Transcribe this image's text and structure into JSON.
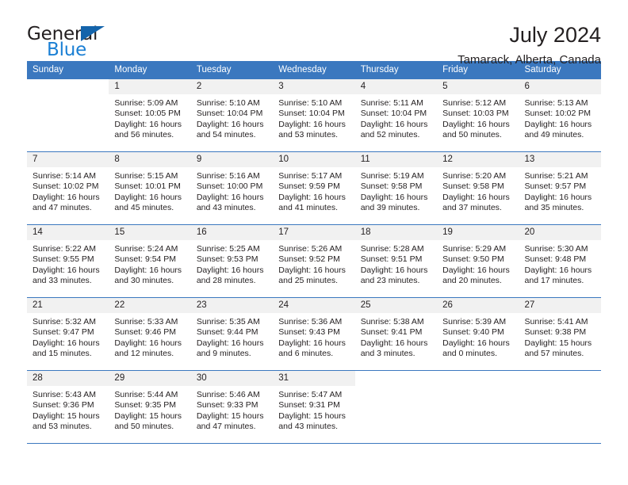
{
  "brand": {
    "name_part1": "General",
    "name_part2": "Blue",
    "triangle_color": "#1464ab",
    "blue_color": "#1a7fd4"
  },
  "header": {
    "title": "July 2024",
    "location": "Tamarack, Alberta, Canada"
  },
  "theme": {
    "header_blue": "#3b78bf",
    "daynum_band": "#f1f1f1",
    "text": "#231f20"
  },
  "weekday_headers": [
    "Sunday",
    "Monday",
    "Tuesday",
    "Wednesday",
    "Thursday",
    "Friday",
    "Saturday"
  ],
  "weeks": [
    [
      {
        "day": "",
        "sunrise": "",
        "sunset": "",
        "daylight1": "",
        "daylight2": "",
        "blank": true
      },
      {
        "day": "1",
        "sunrise": "Sunrise: 5:09 AM",
        "sunset": "Sunset: 10:05 PM",
        "daylight1": "Daylight: 16 hours",
        "daylight2": "and 56 minutes."
      },
      {
        "day": "2",
        "sunrise": "Sunrise: 5:10 AM",
        "sunset": "Sunset: 10:04 PM",
        "daylight1": "Daylight: 16 hours",
        "daylight2": "and 54 minutes."
      },
      {
        "day": "3",
        "sunrise": "Sunrise: 5:10 AM",
        "sunset": "Sunset: 10:04 PM",
        "daylight1": "Daylight: 16 hours",
        "daylight2": "and 53 minutes."
      },
      {
        "day": "4",
        "sunrise": "Sunrise: 5:11 AM",
        "sunset": "Sunset: 10:04 PM",
        "daylight1": "Daylight: 16 hours",
        "daylight2": "and 52 minutes."
      },
      {
        "day": "5",
        "sunrise": "Sunrise: 5:12 AM",
        "sunset": "Sunset: 10:03 PM",
        "daylight1": "Daylight: 16 hours",
        "daylight2": "and 50 minutes."
      },
      {
        "day": "6",
        "sunrise": "Sunrise: 5:13 AM",
        "sunset": "Sunset: 10:02 PM",
        "daylight1": "Daylight: 16 hours",
        "daylight2": "and 49 minutes."
      }
    ],
    [
      {
        "day": "7",
        "sunrise": "Sunrise: 5:14 AM",
        "sunset": "Sunset: 10:02 PM",
        "daylight1": "Daylight: 16 hours",
        "daylight2": "and 47 minutes."
      },
      {
        "day": "8",
        "sunrise": "Sunrise: 5:15 AM",
        "sunset": "Sunset: 10:01 PM",
        "daylight1": "Daylight: 16 hours",
        "daylight2": "and 45 minutes."
      },
      {
        "day": "9",
        "sunrise": "Sunrise: 5:16 AM",
        "sunset": "Sunset: 10:00 PM",
        "daylight1": "Daylight: 16 hours",
        "daylight2": "and 43 minutes."
      },
      {
        "day": "10",
        "sunrise": "Sunrise: 5:17 AM",
        "sunset": "Sunset: 9:59 PM",
        "daylight1": "Daylight: 16 hours",
        "daylight2": "and 41 minutes."
      },
      {
        "day": "11",
        "sunrise": "Sunrise: 5:19 AM",
        "sunset": "Sunset: 9:58 PM",
        "daylight1": "Daylight: 16 hours",
        "daylight2": "and 39 minutes."
      },
      {
        "day": "12",
        "sunrise": "Sunrise: 5:20 AM",
        "sunset": "Sunset: 9:58 PM",
        "daylight1": "Daylight: 16 hours",
        "daylight2": "and 37 minutes."
      },
      {
        "day": "13",
        "sunrise": "Sunrise: 5:21 AM",
        "sunset": "Sunset: 9:57 PM",
        "daylight1": "Daylight: 16 hours",
        "daylight2": "and 35 minutes."
      }
    ],
    [
      {
        "day": "14",
        "sunrise": "Sunrise: 5:22 AM",
        "sunset": "Sunset: 9:55 PM",
        "daylight1": "Daylight: 16 hours",
        "daylight2": "and 33 minutes."
      },
      {
        "day": "15",
        "sunrise": "Sunrise: 5:24 AM",
        "sunset": "Sunset: 9:54 PM",
        "daylight1": "Daylight: 16 hours",
        "daylight2": "and 30 minutes."
      },
      {
        "day": "16",
        "sunrise": "Sunrise: 5:25 AM",
        "sunset": "Sunset: 9:53 PM",
        "daylight1": "Daylight: 16 hours",
        "daylight2": "and 28 minutes."
      },
      {
        "day": "17",
        "sunrise": "Sunrise: 5:26 AM",
        "sunset": "Sunset: 9:52 PM",
        "daylight1": "Daylight: 16 hours",
        "daylight2": "and 25 minutes."
      },
      {
        "day": "18",
        "sunrise": "Sunrise: 5:28 AM",
        "sunset": "Sunset: 9:51 PM",
        "daylight1": "Daylight: 16 hours",
        "daylight2": "and 23 minutes."
      },
      {
        "day": "19",
        "sunrise": "Sunrise: 5:29 AM",
        "sunset": "Sunset: 9:50 PM",
        "daylight1": "Daylight: 16 hours",
        "daylight2": "and 20 minutes."
      },
      {
        "day": "20",
        "sunrise": "Sunrise: 5:30 AM",
        "sunset": "Sunset: 9:48 PM",
        "daylight1": "Daylight: 16 hours",
        "daylight2": "and 17 minutes."
      }
    ],
    [
      {
        "day": "21",
        "sunrise": "Sunrise: 5:32 AM",
        "sunset": "Sunset: 9:47 PM",
        "daylight1": "Daylight: 16 hours",
        "daylight2": "and 15 minutes."
      },
      {
        "day": "22",
        "sunrise": "Sunrise: 5:33 AM",
        "sunset": "Sunset: 9:46 PM",
        "daylight1": "Daylight: 16 hours",
        "daylight2": "and 12 minutes."
      },
      {
        "day": "23",
        "sunrise": "Sunrise: 5:35 AM",
        "sunset": "Sunset: 9:44 PM",
        "daylight1": "Daylight: 16 hours",
        "daylight2": "and 9 minutes."
      },
      {
        "day": "24",
        "sunrise": "Sunrise: 5:36 AM",
        "sunset": "Sunset: 9:43 PM",
        "daylight1": "Daylight: 16 hours",
        "daylight2": "and 6 minutes."
      },
      {
        "day": "25",
        "sunrise": "Sunrise: 5:38 AM",
        "sunset": "Sunset: 9:41 PM",
        "daylight1": "Daylight: 16 hours",
        "daylight2": "and 3 minutes."
      },
      {
        "day": "26",
        "sunrise": "Sunrise: 5:39 AM",
        "sunset": "Sunset: 9:40 PM",
        "daylight1": "Daylight: 16 hours",
        "daylight2": "and 0 minutes."
      },
      {
        "day": "27",
        "sunrise": "Sunrise: 5:41 AM",
        "sunset": "Sunset: 9:38 PM",
        "daylight1": "Daylight: 15 hours",
        "daylight2": "and 57 minutes."
      }
    ],
    [
      {
        "day": "28",
        "sunrise": "Sunrise: 5:43 AM",
        "sunset": "Sunset: 9:36 PM",
        "daylight1": "Daylight: 15 hours",
        "daylight2": "and 53 minutes."
      },
      {
        "day": "29",
        "sunrise": "Sunrise: 5:44 AM",
        "sunset": "Sunset: 9:35 PM",
        "daylight1": "Daylight: 15 hours",
        "daylight2": "and 50 minutes."
      },
      {
        "day": "30",
        "sunrise": "Sunrise: 5:46 AM",
        "sunset": "Sunset: 9:33 PM",
        "daylight1": "Daylight: 15 hours",
        "daylight2": "and 47 minutes."
      },
      {
        "day": "31",
        "sunrise": "Sunrise: 5:47 AM",
        "sunset": "Sunset: 9:31 PM",
        "daylight1": "Daylight: 15 hours",
        "daylight2": "and 43 minutes."
      },
      {
        "day": "",
        "sunrise": "",
        "sunset": "",
        "daylight1": "",
        "daylight2": "",
        "blank": true
      },
      {
        "day": "",
        "sunrise": "",
        "sunset": "",
        "daylight1": "",
        "daylight2": "",
        "blank": true
      },
      {
        "day": "",
        "sunrise": "",
        "sunset": "",
        "daylight1": "",
        "daylight2": "",
        "blank": true
      }
    ]
  ]
}
